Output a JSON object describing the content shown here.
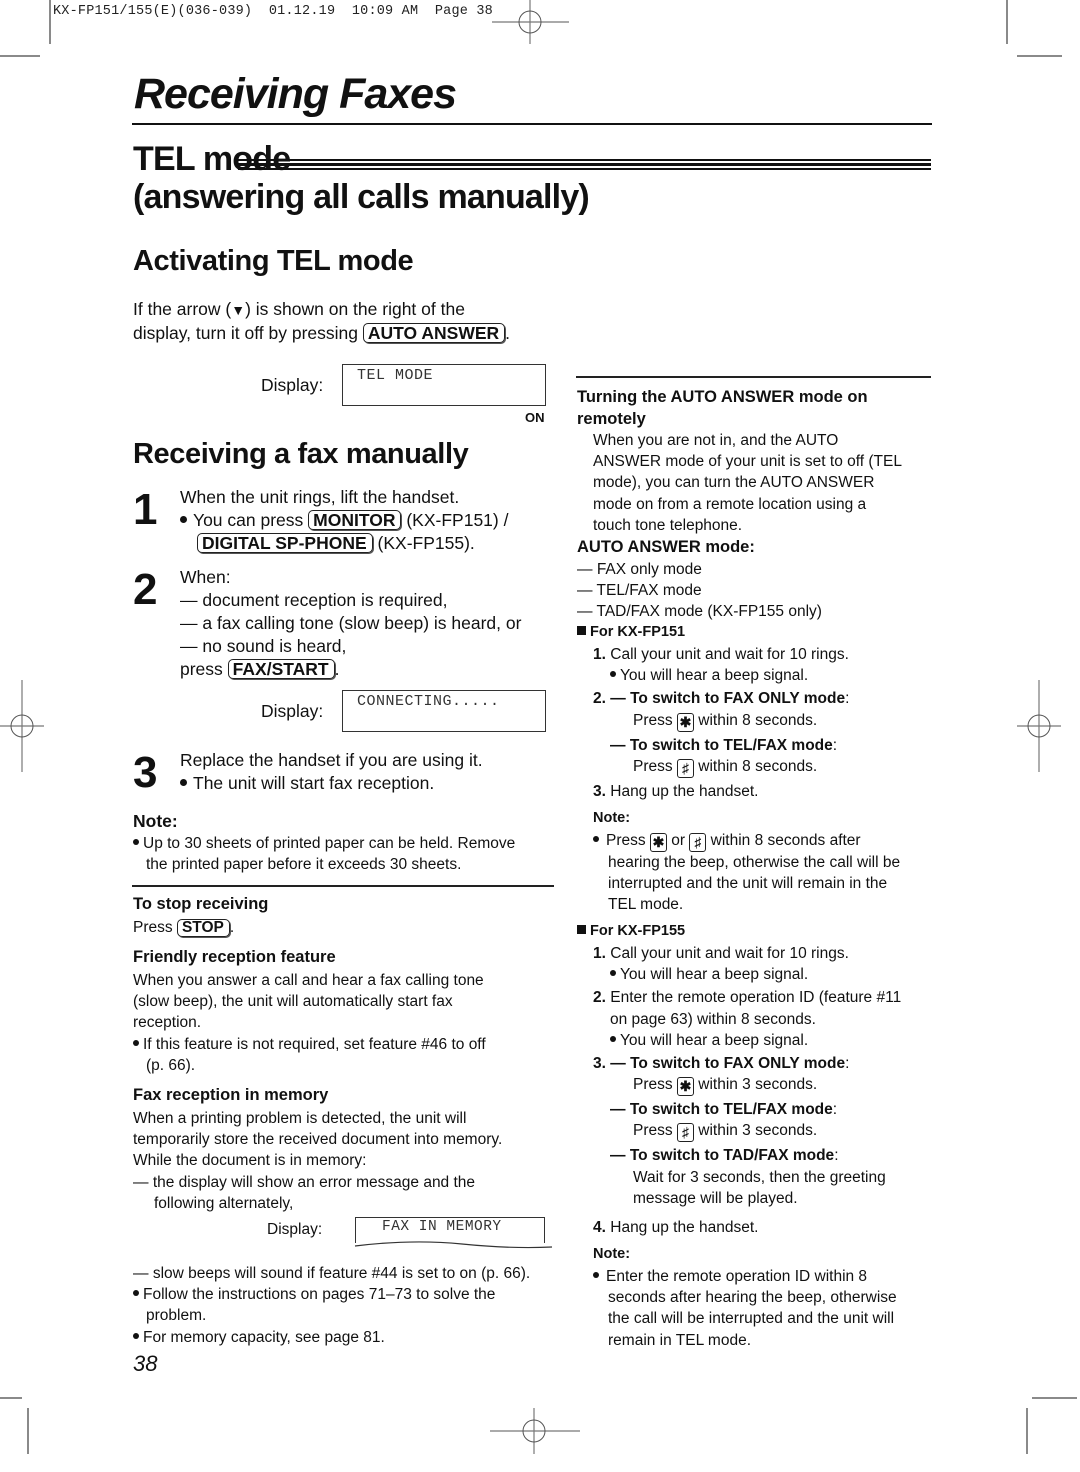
{
  "slug": "KX-FP151/155(E)(036-039)  01.12.19  10:09 AM  Page 38",
  "page_title": "Receiving Faxes",
  "section": {
    "title_line1": "TEL mode",
    "title_line2": "(answering all calls manually)"
  },
  "activating": {
    "heading": "Activating TEL mode",
    "text_line1_a": "If the arrow (",
    "arrow_glyph": "▼",
    "text_line1_b": ") is shown on the right of the",
    "text_line2_a": "display, turn it off by pressing",
    "key": "AUTO ANSWER",
    "text_line2_b": ".",
    "display_label": "Display:",
    "display_value": "TEL MODE",
    "on_label": "ON"
  },
  "receiving_manually": {
    "heading": "Receiving a fax manually",
    "steps": [
      {
        "num": "1",
        "line1": "When the unit rings, lift the handset.",
        "line2_a": "You can press",
        "key1": "MONITOR",
        "line2_b": "(KX-FP151) /",
        "key2": "DIGITAL SP-PHONE",
        "line3_b": "(KX-FP155)."
      },
      {
        "num": "2",
        "line1": "When:",
        "dash_items": [
          "document reception is required,",
          "a fax calling tone (slow beep) is heard, or",
          "no sound is heard,"
        ],
        "press_label": "press",
        "key": "FAX/START",
        "press_end": ".",
        "display_label": "Display:",
        "display_value": "CONNECTING....."
      },
      {
        "num": "3",
        "line1": "Replace the handset if you are using it.",
        "bullet": "The unit will start fax reception."
      }
    ],
    "note_label": "Note:",
    "note_line1": "Up to 30 sheets of printed paper can be held. Remove",
    "note_line2": "the printed paper before it exceeds 30 sheets."
  },
  "stop_receiving": {
    "heading": "To stop receiving",
    "press": "Press",
    "key": "STOP",
    "end": "."
  },
  "friendly": {
    "heading": "Friendly reception feature",
    "lines": [
      "When you answer a call and hear a fax calling tone",
      "(slow beep), the unit will automatically start fax",
      "reception."
    ],
    "bullet_line1": "If this feature is not required, set feature #46 to off",
    "bullet_line2": "(p. 66)."
  },
  "memory": {
    "heading": "Fax reception in memory",
    "lines": [
      "When a printing problem is detected, the unit will",
      "temporarily store the received document into memory.",
      "While the document is in memory:"
    ],
    "dash1_line1": "the display will show an error message and the",
    "dash1_line2": "following alternately,",
    "display_label": "Display:",
    "display_value": "FAX IN MEMORY",
    "dash2": "slow beeps will sound if feature #44 is set to on (p. 66).",
    "bullet1_line1": "Follow the instructions on pages 71–73 to solve the",
    "bullet1_line2": "problem.",
    "bullet2": "For memory capacity, see page 81."
  },
  "page_number": "38",
  "remote": {
    "heading_line1": "Turning the AUTO ANSWER mode on",
    "heading_line2": "remotely",
    "lines": [
      "When you are not in, and the AUTO",
      "ANSWER mode of your unit is set to off (TEL",
      "mode), you can turn the AUTO ANSWER",
      "mode on from a remote location using a",
      "touch tone telephone."
    ],
    "modes_heading": "AUTO ANSWER mode:",
    "modes": [
      "FAX only mode",
      "TEL/FAX mode",
      "TAD/FAX mode (KX-FP155 only)"
    ],
    "fp151": {
      "heading": "For KX-FP151",
      "s1_num": "1.",
      "s1": "Call your unit and wait for 10 rings.",
      "s1_bullet": "You will hear a beep signal.",
      "s2_num": "2.",
      "s2a_bold": "To switch to FAX ONLY mode",
      "s2a_press": "Press",
      "s2a_key": "✱",
      "s2a_rest": "within 8 seconds.",
      "s2b_bold": "To switch to TEL/FAX mode",
      "s2b_press": "Press",
      "s2b_key": "♯",
      "s2b_rest": "within 8 seconds.",
      "s3_num": "3.",
      "s3": "Hang up the handset.",
      "note_label": "Note:",
      "note_press": "Press",
      "note_key1": "✱",
      "note_or": "or",
      "note_key2": "♯",
      "note_line1_rest": "within 8 seconds after",
      "note_line2": "hearing the beep, otherwise the call will be",
      "note_line3": "interrupted and the unit will remain in the",
      "note_line4": "TEL mode."
    },
    "fp155": {
      "heading": "For KX-FP155",
      "s1_num": "1.",
      "s1": "Call your unit and wait for 10 rings.",
      "s1_bullet": "You will hear a beep signal.",
      "s2_num": "2.",
      "s2_line1": "Enter the remote operation ID (feature #11",
      "s2_line2": "on page 63) within 8 seconds.",
      "s2_bullet": "You will hear a beep signal.",
      "s3_num": "3.",
      "s3a_bold": "To switch to FAX ONLY mode",
      "s3a_press": "Press",
      "s3a_key": "✱",
      "s3a_rest": "within 3 seconds.",
      "s3b_bold": "To switch to TEL/FAX mode",
      "s3b_press": "Press",
      "s3b_key": "♯",
      "s3b_rest": "within 3 seconds.",
      "s3c_bold": "To switch to TAD/FAX mode",
      "s3c_line1": "Wait for 3 seconds, then the greeting",
      "s3c_line2": "message will be played.",
      "s4_num": "4.",
      "s4": "Hang up the handset.",
      "note_label": "Note:",
      "note_lines": [
        "Enter the remote operation ID within 8",
        "seconds after hearing the beep, otherwise",
        "the call will be interrupted and the unit will",
        "remain in TEL mode."
      ]
    }
  },
  "symbols": {
    "dash": "—",
    "colon": ":"
  }
}
